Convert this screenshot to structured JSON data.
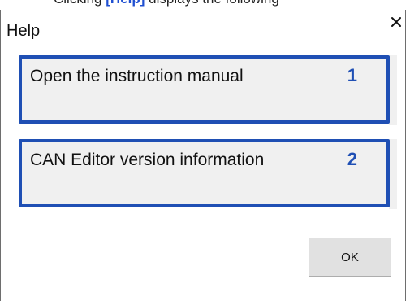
{
  "context_strip": {
    "prefix": "Clicking ",
    "highlight": "[Help]",
    "suffix": " displays the following"
  },
  "dialog": {
    "title": "Help",
    "close_icon": "close-icon",
    "options": [
      {
        "label": "Open the instruction manual",
        "number": "1"
      },
      {
        "label": "CAN Editor version information",
        "number": "2"
      }
    ],
    "ok_label": "OK"
  },
  "colors": {
    "option_border": "#1f4fb4",
    "option_background": "#f0f0f0",
    "number_color": "#1f4fb4",
    "ok_background": "#e1e1e1"
  }
}
